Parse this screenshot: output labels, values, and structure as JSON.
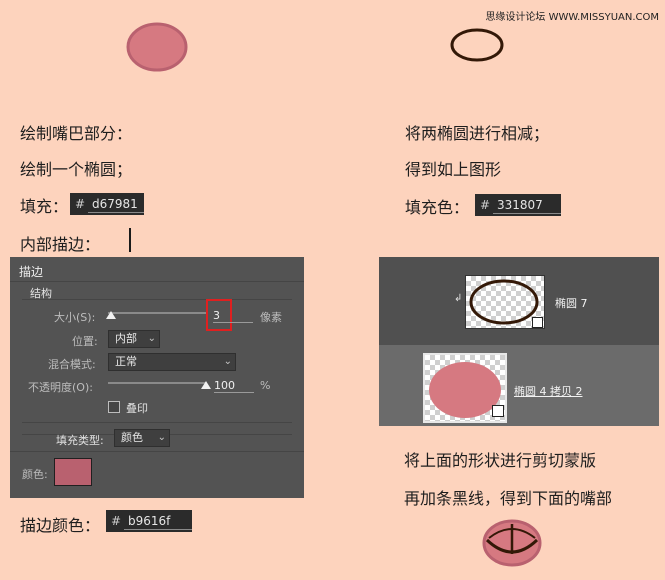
{
  "watermark": "思缘设计论坛 WWW.MISSYUAN.COM",
  "left_steps": {
    "step1": "绘制嘴巴部分：",
    "step2": "绘制一个椭圆；",
    "fill_label": "填充：",
    "fill_hex": "d67981",
    "inner_stroke_label": "内部描边：",
    "stroke_color_label": "描边颜色：",
    "stroke_hex": "b9616f"
  },
  "right_steps": {
    "step1": "将两椭圆进行相减；",
    "step2": "得到如上图形",
    "fill_label": "填充色：",
    "fill_hex": "331807",
    "clip_text": "将上面的形状进行剪切蒙版",
    "line_text": "再加条黑线，得到下面的嘴部"
  },
  "stroke_panel": {
    "title": "描边",
    "structure": "结构",
    "size_label": "大小(S):",
    "size_value": "3",
    "size_unit": "像素",
    "position_label": "位置:",
    "position_value": "内部",
    "blend_label": "混合模式:",
    "blend_value": "正常",
    "opacity_label": "不透明度(O):",
    "opacity_value": "100",
    "opacity_unit": "%",
    "overprint_label": "叠印",
    "fill_type_label": "填充类型:",
    "fill_type_value": "颜色",
    "color_label": "颜色:",
    "size_slider": 0.03,
    "opacity_slider": 1.0
  },
  "layers_panel": {
    "layers": [
      {
        "name": "椭圆 7"
      },
      {
        "name": "椭圆 4 拷贝 2"
      }
    ]
  },
  "colors": {
    "background": "#fdd3bd",
    "mouth_fill": "#d67981",
    "mouth_stroke": "#b9616f",
    "ring": "#331807",
    "panel": "#535353",
    "highlight_red": "#e02020"
  },
  "icons": {
    "hash": "#",
    "chevron": "chevron-down-icon",
    "link": "clip-link-icon",
    "shape": "shape-layer-icon"
  }
}
